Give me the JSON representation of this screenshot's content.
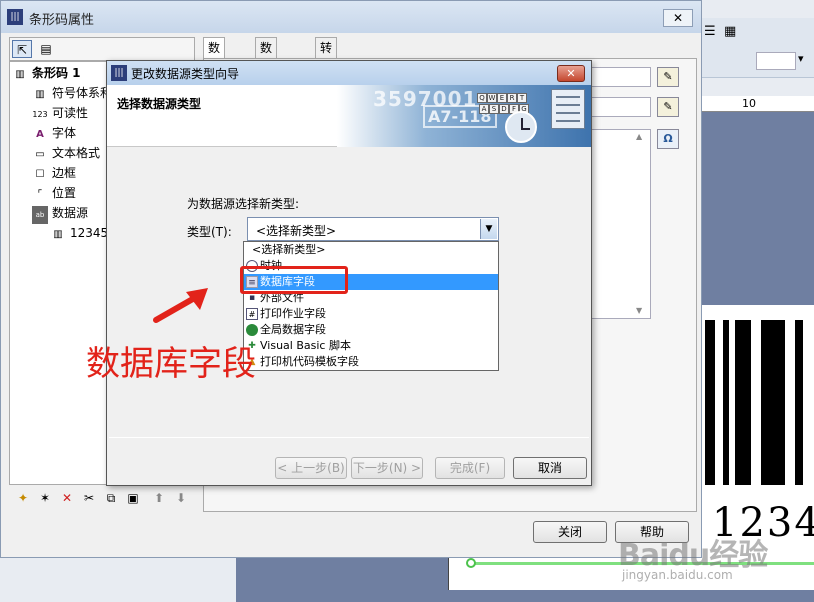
{
  "background_app": {
    "ruler_label": "10",
    "barcode_digits": "1234"
  },
  "properties_window": {
    "title": "条形码属性",
    "close_label": "✕",
    "tree": [
      {
        "label": "条形码 1",
        "icon": "barcode-icon"
      },
      {
        "label": "符号体系和",
        "icon": "symbology-icon"
      },
      {
        "label": "可读性",
        "icon": "readability-icon"
      },
      {
        "label": "字体",
        "icon": "font-icon"
      },
      {
        "label": "文本格式",
        "icon": "text-format-icon"
      },
      {
        "label": "边框",
        "icon": "border-icon"
      },
      {
        "label": "位置",
        "icon": "position-icon"
      },
      {
        "label": "数据源",
        "icon": "datasource-icon"
      },
      {
        "label": "12345",
        "icon": "barcode-small-icon"
      }
    ],
    "tabs": [
      "数据源",
      "数据类型",
      "转换"
    ],
    "close_button": "关闭",
    "help_button": "帮助"
  },
  "wizard": {
    "title": "更改数据源类型向导",
    "close_label": "✕",
    "heading": "选择数据源类型",
    "banner_text_1": "3597001",
    "banner_text_2": "A7-118",
    "keys_row1": [
      "Q",
      "W",
      "E",
      "R",
      "T"
    ],
    "keys_row2": [
      "A",
      "S",
      "D",
      "F",
      "G"
    ],
    "prompt": "为数据源选择新类型:",
    "type_label": "类型(T):",
    "select_value": "<选择新类型>",
    "options": [
      {
        "label": "<选择新类型>",
        "icon": ""
      },
      {
        "label": "时钟",
        "icon": "clock-icon"
      },
      {
        "label": "数据库字段",
        "icon": "database-icon"
      },
      {
        "label": "外部文件",
        "icon": "external-file-icon"
      },
      {
        "label": "打印作业字段",
        "icon": "print-job-icon"
      },
      {
        "label": "全局数据字段",
        "icon": "globe-icon"
      },
      {
        "label": "Visual Basic 脚本",
        "icon": "vb-script-icon"
      },
      {
        "label": "打印机代码模板字段",
        "icon": "printer-code-icon"
      }
    ],
    "selected_option": "数据库字段",
    "buttons": {
      "back": "< 上一步(B)",
      "next": "下一步(N) >",
      "finish": "完成(F)",
      "cancel": "取消"
    }
  },
  "annotation": {
    "caption": "数据库字段",
    "color": "#e2231a"
  },
  "watermark": {
    "main": "Baidu经验",
    "sub": "jingyan.baidu.com"
  }
}
